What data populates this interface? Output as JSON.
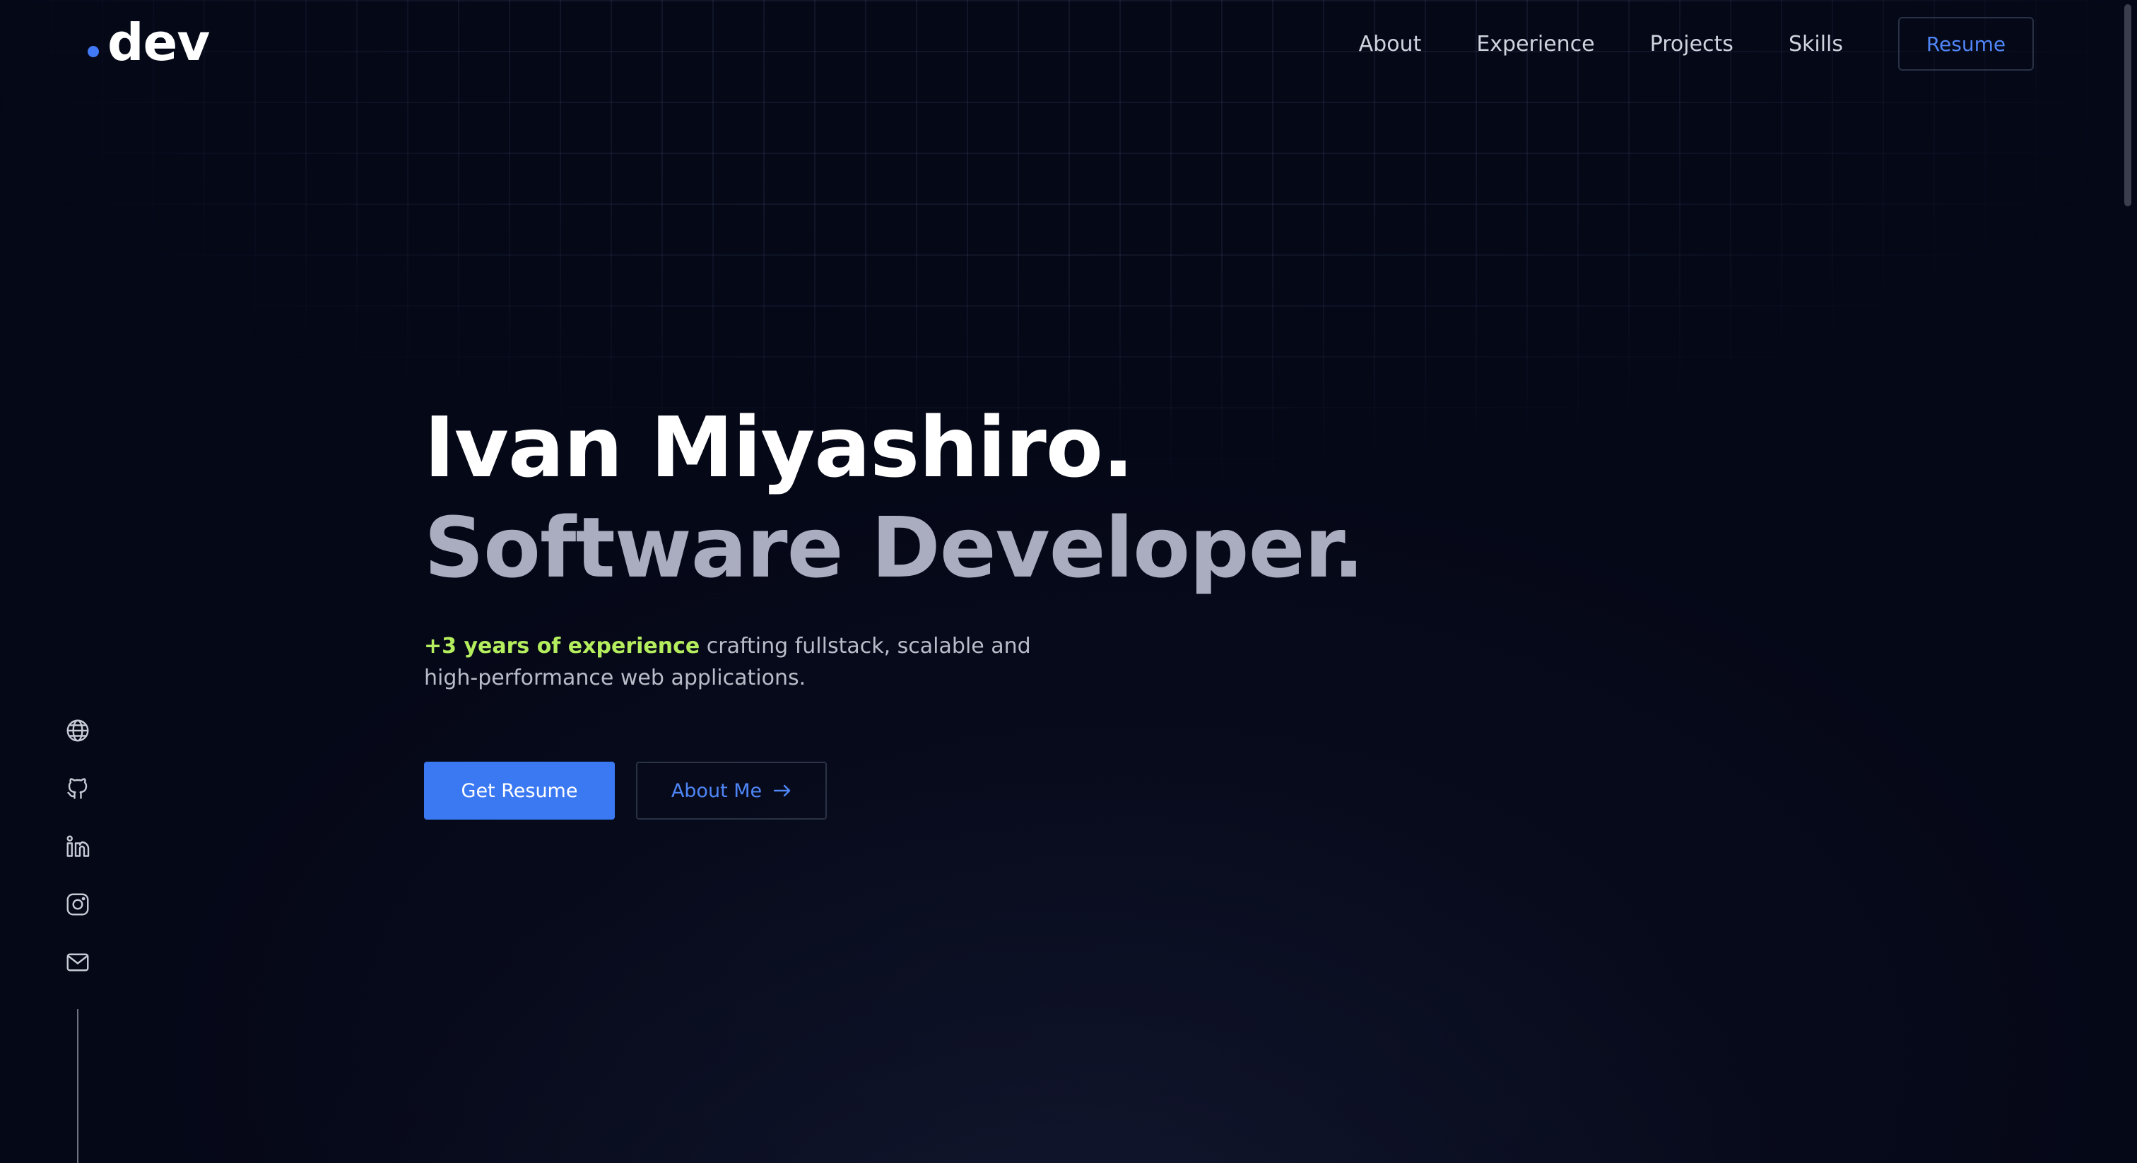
{
  "logo": {
    "text": "dev",
    "accent_color": "#4179f6"
  },
  "nav": {
    "items": [
      "About",
      "Experience",
      "Projects",
      "Skills"
    ],
    "resume_label": "Resume"
  },
  "hero": {
    "name": "Ivan Miyashiro.",
    "role": "Software Developer.",
    "highlight": "+3 years of experience",
    "description": " crafting fullstack, scalable and high-performance web applications.",
    "primary_button": "Get Resume",
    "secondary_button": "About Me"
  },
  "socials": [
    "globe-icon",
    "github-icon",
    "linkedin-icon",
    "instagram-icon",
    "mail-icon"
  ],
  "colors": {
    "background": "#050817",
    "accent_blue": "#3b79f3",
    "highlight_green": "#b4ed5d",
    "role_gray": "#a9adbf"
  }
}
